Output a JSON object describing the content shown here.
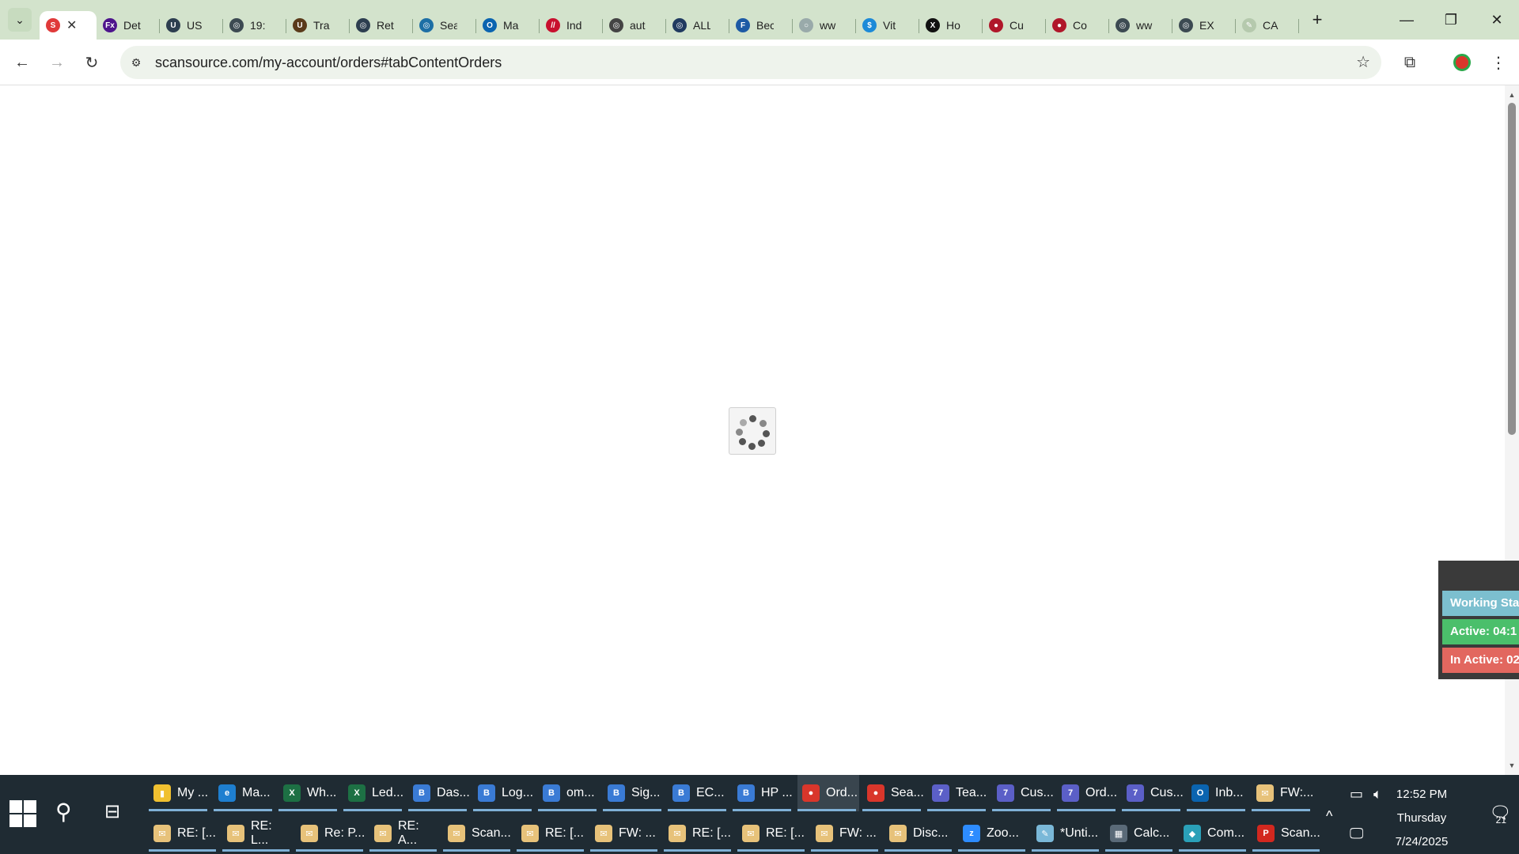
{
  "browser": {
    "tabs": [
      {
        "label": "",
        "favicon": "scansource-logo-icon",
        "color": "#e03a3a",
        "glyph": "S",
        "active": true
      },
      {
        "label": "Det",
        "favicon": "fedex-logo-icon",
        "color": "#4d148c",
        "glyph": "Fx"
      },
      {
        "label": "US",
        "favicon": "usps-icon",
        "color": "#2d3e50",
        "glyph": "U"
      },
      {
        "label": "19:",
        "favicon": "globe-icon",
        "color": "#3c4a52",
        "glyph": "◎"
      },
      {
        "label": "Tra",
        "favicon": "ups-logo-icon",
        "color": "#5a3a1a",
        "glyph": "U"
      },
      {
        "label": "Ret",
        "favicon": "globe-icon",
        "color": "#2d3e50",
        "glyph": "◎"
      },
      {
        "label": "Sea",
        "favicon": "globe-icon",
        "color": "#1d6fa5",
        "glyph": "◎"
      },
      {
        "label": "Ma",
        "favicon": "outlook-icon",
        "color": "#0a64b0",
        "glyph": "O"
      },
      {
        "label": "Ind",
        "favicon": "ingram-icon",
        "color": "#c8102e",
        "glyph": "//"
      },
      {
        "label": "aut",
        "favicon": "globe-icon",
        "color": "#444",
        "glyph": "◎"
      },
      {
        "label": "ALL",
        "favicon": "globe-icon",
        "color": "#203a60",
        "glyph": "◎"
      },
      {
        "label": "Bec",
        "favicon": "globe-icon",
        "color": "#1d5aa5",
        "glyph": "F"
      },
      {
        "label": "ww",
        "favicon": "loading-icon",
        "color": "#9aa",
        "glyph": "○"
      },
      {
        "label": "Vit",
        "favicon": "dollar-icon",
        "color": "#1c8ad8",
        "glyph": "$"
      },
      {
        "label": "Ho",
        "favicon": "x-logo-icon",
        "color": "#111",
        "glyph": "X"
      },
      {
        "label": "Cu",
        "favicon": "red-circle-icon",
        "color": "#b0172a",
        "glyph": "●"
      },
      {
        "label": "Co",
        "favicon": "red-circle-icon",
        "color": "#b0172a",
        "glyph": "●"
      },
      {
        "label": "ww",
        "favicon": "globe-icon",
        "color": "#3c4a52",
        "glyph": "◎"
      },
      {
        "label": "EX",
        "favicon": "globe-icon",
        "color": "#3c4a52",
        "glyph": "◎"
      },
      {
        "label": "CA",
        "favicon": "feather-icon",
        "color": "#b5c9ad",
        "glyph": "✎"
      }
    ],
    "url": "scansource.com/my-account/orders#tabContentOrders"
  },
  "status_widget": {
    "working": "Working Sta",
    "active": "Active: 04:1",
    "inactive": "In Active: 02",
    "colors": {
      "working": "#7cbfcf",
      "active": "#4bbf6b",
      "inactive": "#e2675f"
    }
  },
  "taskbar": {
    "row1": [
      {
        "label": "My ...",
        "icon": "folder-icon",
        "color": "#f0c030",
        "glyph": "▮"
      },
      {
        "label": "Ma...",
        "icon": "edge-icon",
        "color": "#1e7fd0",
        "glyph": "e"
      },
      {
        "label": "Wh...",
        "icon": "excel-icon",
        "color": "#1d7044",
        "glyph": "X"
      },
      {
        "label": "Led...",
        "icon": "excel-icon",
        "color": "#1d7044",
        "glyph": "X"
      },
      {
        "label": "Das...",
        "icon": "chrome-icon",
        "color": "#3a7bd5",
        "glyph": "B"
      },
      {
        "label": "Log...",
        "icon": "chrome-icon",
        "color": "#3a7bd5",
        "glyph": "B"
      },
      {
        "label": "om...",
        "icon": "chrome-icon",
        "color": "#3a7bd5",
        "glyph": "B"
      },
      {
        "label": "Sig...",
        "icon": "chrome-icon",
        "color": "#3a7bd5",
        "glyph": "B"
      },
      {
        "label": "EC...",
        "icon": "chrome-icon",
        "color": "#3a7bd5",
        "glyph": "B"
      },
      {
        "label": "HP ...",
        "icon": "chrome-icon",
        "color": "#3a7bd5",
        "glyph": "B"
      },
      {
        "label": "Ord...",
        "icon": "chrome-icon",
        "color": "#d9362b",
        "glyph": "●"
      },
      {
        "label": "Sea...",
        "icon": "chrome-icon",
        "color": "#d9362b",
        "glyph": "●"
      },
      {
        "label": "Tea...",
        "icon": "teams-icon",
        "color": "#5b5fc7",
        "glyph": "7"
      },
      {
        "label": "Cus...",
        "icon": "teams-icon",
        "color": "#5b5fc7",
        "glyph": "7"
      },
      {
        "label": "Ord...",
        "icon": "teams-icon",
        "color": "#5b5fc7",
        "glyph": "7"
      },
      {
        "label": "Cus...",
        "icon": "teams-icon",
        "color": "#5b5fc7",
        "glyph": "7"
      },
      {
        "label": "Inb...",
        "icon": "outlook-icon",
        "color": "#0a64b0",
        "glyph": "O"
      },
      {
        "label": "FW:...",
        "icon": "mail-icon",
        "color": "#e7c27a",
        "glyph": "✉"
      }
    ],
    "row2": [
      {
        "label": "RE: [...",
        "icon": "mail-icon",
        "color": "#e7c27a",
        "glyph": "✉"
      },
      {
        "label": "RE: L...",
        "icon": "mail-icon",
        "color": "#e7c27a",
        "glyph": "✉"
      },
      {
        "label": "Re: P...",
        "icon": "mail-icon",
        "color": "#e7c27a",
        "glyph": "✉"
      },
      {
        "label": "RE: A...",
        "icon": "mail-icon",
        "color": "#e7c27a",
        "glyph": "✉"
      },
      {
        "label": "Scan...",
        "icon": "mail-icon",
        "color": "#e7c27a",
        "glyph": "✉"
      },
      {
        "label": "RE: [...",
        "icon": "mail-icon",
        "color": "#e7c27a",
        "glyph": "✉"
      },
      {
        "label": "FW: ...",
        "icon": "mail-icon",
        "color": "#e7c27a",
        "glyph": "✉"
      },
      {
        "label": "RE: [...",
        "icon": "mail-icon",
        "color": "#e7c27a",
        "glyph": "✉"
      },
      {
        "label": "RE: [...",
        "icon": "mail-icon",
        "color": "#e7c27a",
        "glyph": "✉"
      },
      {
        "label": "FW: ...",
        "icon": "mail-icon",
        "color": "#e7c27a",
        "glyph": "✉"
      },
      {
        "label": "Disc...",
        "icon": "mail-icon",
        "color": "#e7c27a",
        "glyph": "✉"
      },
      {
        "label": "Zoo...",
        "icon": "zoom-icon",
        "color": "#2d8cff",
        "glyph": "z"
      },
      {
        "label": "*Unti...",
        "icon": "notepad-icon",
        "color": "#7ab8d8",
        "glyph": "✎"
      },
      {
        "label": "Calc...",
        "icon": "calculator-icon",
        "color": "#5a6a78",
        "glyph": "▦"
      },
      {
        "label": "Com...",
        "icon": "app-icon",
        "color": "#2aa0b8",
        "glyph": "◆"
      },
      {
        "label": "Scan...",
        "icon": "pdf-icon",
        "color": "#d2281f",
        "glyph": "P"
      }
    ],
    "clock": {
      "time": "12:52 PM",
      "day": "Thursday",
      "date": "7/24/2025"
    },
    "notifications": "21"
  }
}
